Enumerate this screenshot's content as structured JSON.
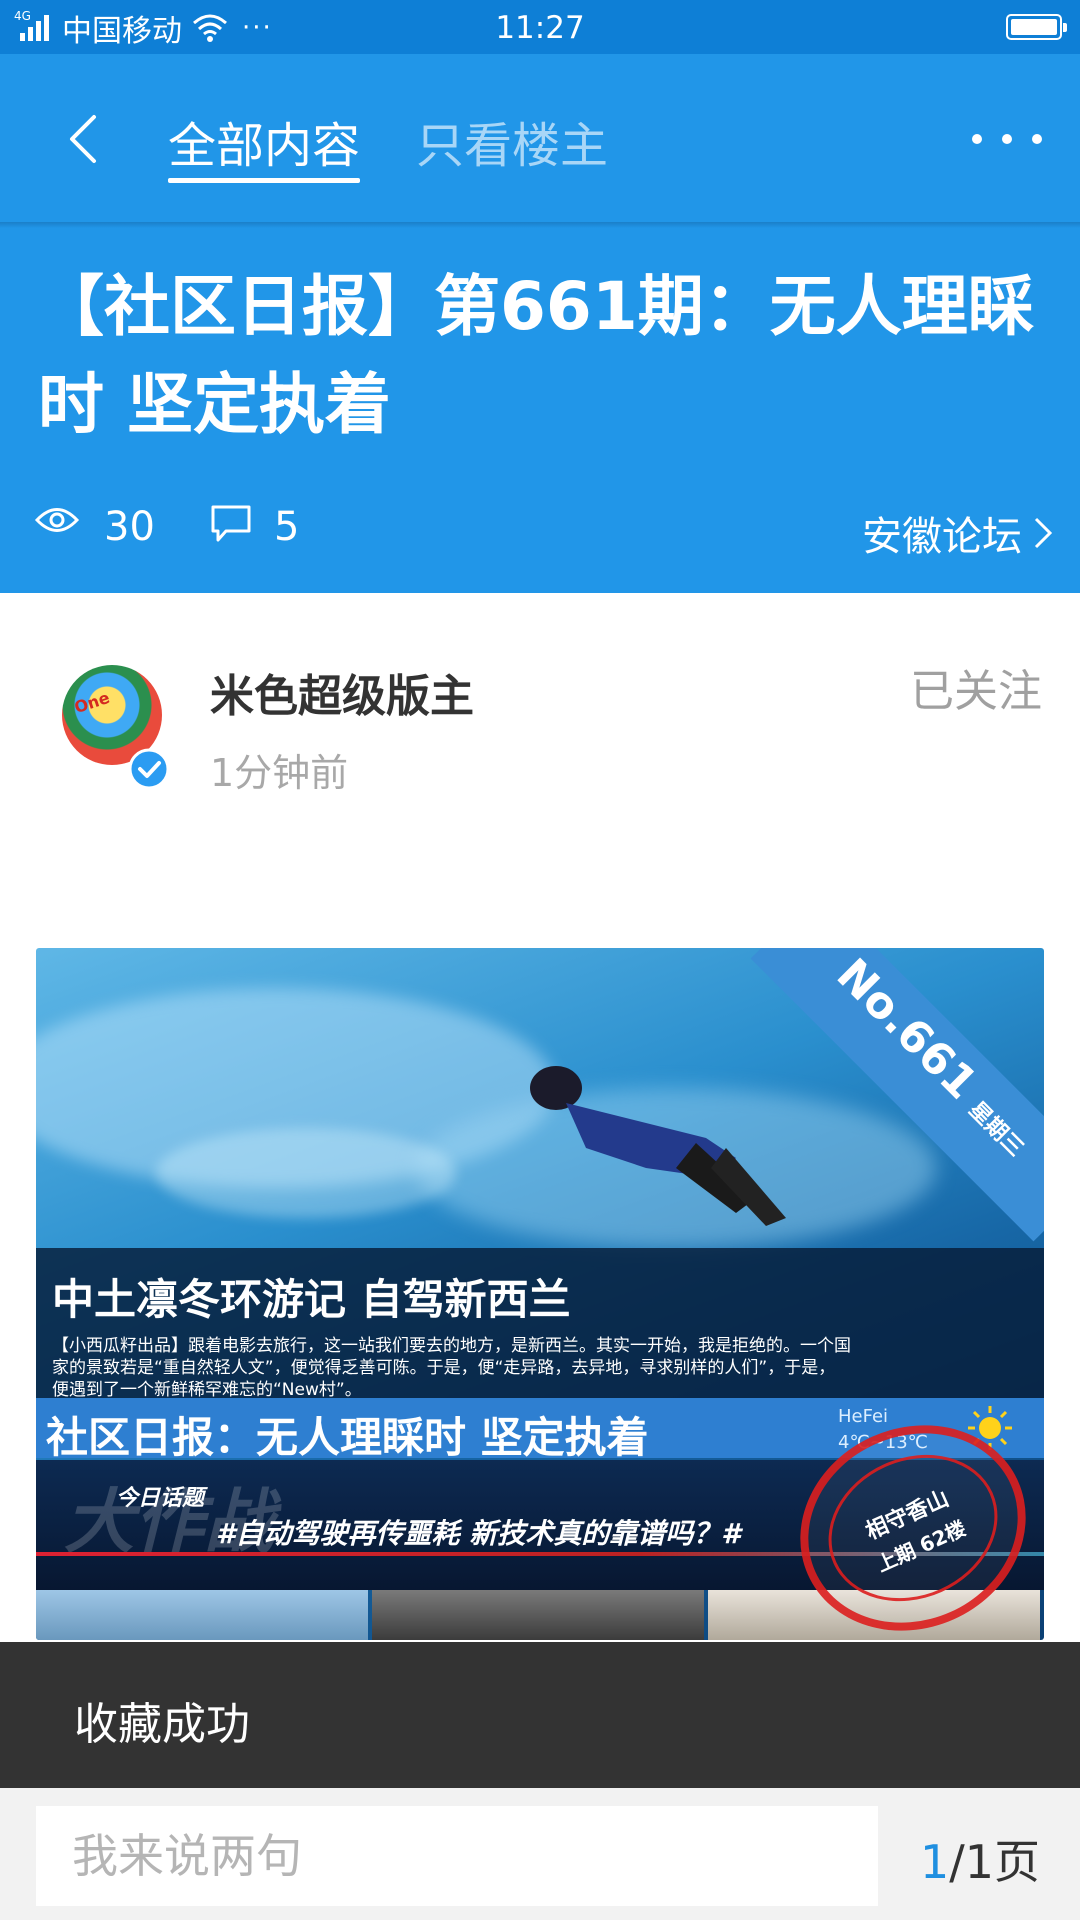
{
  "status_bar": {
    "network": "4G",
    "carrier": "中国移动",
    "dots": "···",
    "time": "11:27"
  },
  "nav": {
    "tab_all": "全部内容",
    "tab_owner": "只看楼主"
  },
  "post": {
    "title": "【社区日报】第661期：无人理睬时 坚定执着",
    "views": "30",
    "comments": "5",
    "forum": "安徽论坛"
  },
  "author": {
    "avatar_text": "One",
    "name": "米色超级版主",
    "time": "1分钟前",
    "follow_label": "已关注"
  },
  "banner": {
    "ribbon_no": "No.661",
    "ribbon_day": "星期三",
    "caption_title": "中土凛冬环游记 自驾新西兰",
    "caption_text": "【小西瓜籽出品】跟着电影去旅行，这一站我们要去的地方，是新西兰。其实一开始，我是拒绝的。一个国家的景致若是“重自然轻人文”，便觉得乏善可陈。于是，便“走异路，去异地，寻求别样的人们”，于是，便遇到了一个新鲜稀罕难忘的“New村”。",
    "strip_title": "社区日报：无人理睬时 坚定执着",
    "weather_city": "HeFei",
    "weather_temp": "4℃~13℃",
    "watermark": "大作战",
    "topic_label": "今日话题",
    "topic_text": "#自动驾驶再传噩耗 新技术真的靠谱吗？#",
    "stamp_line1": "相守香山",
    "stamp_line2": "上期 62楼"
  },
  "toast": {
    "message": "收藏成功"
  },
  "bottom": {
    "input_placeholder": "我来说两句",
    "page_current": "1",
    "page_total": "/1页"
  },
  "colors": {
    "primary_blue": "#2196e8",
    "status_blue": "#0e7fd6",
    "toast_bg": "#333333",
    "page_highlight": "#1f8fe0",
    "verified": "#2b9cf2"
  },
  "icons": [
    "back-arrow-icon",
    "more-icon",
    "eye-icon",
    "comment-bubble-icon",
    "chevron-right-icon",
    "verified-check-icon",
    "wifi-icon",
    "battery-icon",
    "signal-icon",
    "sun-icon"
  ]
}
